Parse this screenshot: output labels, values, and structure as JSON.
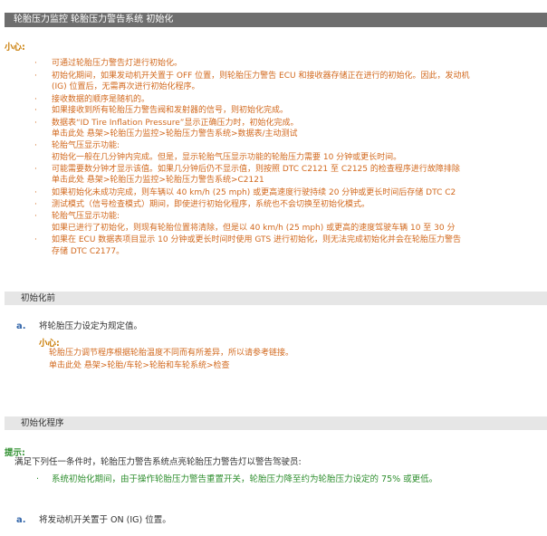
{
  "header": {
    "title": "轮胎压力监控  轮胎压力警告系统  初始化"
  },
  "caution1": {
    "label": "小心:",
    "lines": [
      "可通过轮胎压力警告灯进行初始化。",
      "初始化期间，如果发动机开关置于 OFF 位置，则轮胎压力警告 ECU 和接收器存储正在进行的初始化。因此，发动机",
      "(IG) 位置后，无需再次进行初始化程序。",
      "接收数据的顺序是随机的。",
      "如果接收到所有轮胎压力警告阀和发射器的信号，则初始化完成。",
      "数据表“ID Tire Inflation Pressure”显示正确压力时，初始化完成。",
      "单击此处 悬架>轮胎压力监控>轮胎压力警告系统>数据表/主动测试",
      "轮胎气压显示功能:",
      "初始化一般在几分钟内完成。但是，显示轮胎气压显示功能的轮胎压力需要 10 分钟或更长时间。",
      "可能需要数分钟才显示该值。如果几分钟后仍不显示值，则按照 DTC C2121 至 C2125 的检查程序进行故障排除",
      "单击此处 悬架>轮胎压力监控>轮胎压力警告系统>C2121",
      "如果初始化未成功完成，则车辆以 40 km/h (25 mph) 或更高速度行驶持续 20 分钟或更长时间后存储 DTC C2",
      "测试模式（信号检查模式）期间，即使进行初始化程序，系统也不会切换至初始化模式。",
      "轮胎气压显示功能:",
      "如果已进行了初始化，则现有轮胎位置将清除，但是以 40 km/h (25 mph) 或更高的速度驾驶车辆 10 至 30 分",
      "如果在 ECU 数据表项目显示 10 分钟或更长时间时使用 GTS 进行初始化，则无法完成初始化并会在轮胎压力警告",
      "存储 DTC C2177。"
    ],
    "bullet": "·"
  },
  "section_pre": {
    "title": "初始化前",
    "step_a": {
      "letter": "a.",
      "text": "将轮胎压力设定为规定值。",
      "caution_label": "小心:",
      "caution_line1": "轮胎压力调节程序根据轮胎温度不同而有所差异，所以请参考链接。",
      "caution_line2": "单击此处 悬架>轮胎/车轮>轮胎和车轮系统>检查"
    }
  },
  "section_proc": {
    "title": "初始化程序",
    "hint_label": "提示:",
    "hint_text": "满足下列任一条件时，轮胎压力警告系统点亮轮胎压力警告灯以警告驾驶员:",
    "hint_item": "系统初始化期间，由于操作轮胎压力警告重置开关，轮胎压力降至约为轮胎压力设定的 75% 或更低。",
    "bullet": "·",
    "step_a": {
      "letter": "a.",
      "text": "将发动机开关置于 ON (IG) 位置。"
    }
  }
}
